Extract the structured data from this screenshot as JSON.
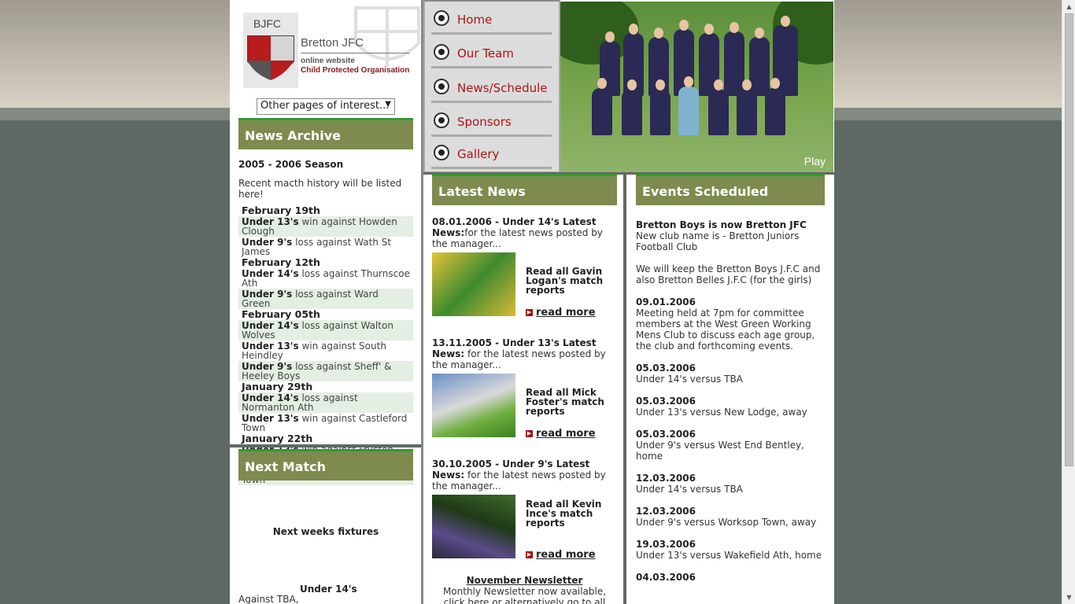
{
  "logo": {
    "abbr": "BJFC",
    "name": "Bretton JFC",
    "sub1": "online website",
    "sub2": "Child Protected Organisation"
  },
  "other_pages": {
    "label": "Other pages of interest..."
  },
  "nav": {
    "items": [
      {
        "label": "Home"
      },
      {
        "label": "Our Team"
      },
      {
        "label": "News/Schedule"
      },
      {
        "label": "Sponsors"
      },
      {
        "label": "Gallery"
      }
    ]
  },
  "photo": {
    "play_label": "Play"
  },
  "news_archive": {
    "heading": "News Archive",
    "season": "2005 - 2006 Season",
    "intro": "Recent macth history will be listed here!",
    "entries": [
      {
        "kind": "date",
        "text": "February 19th"
      },
      {
        "kind": "result",
        "team": "Under 13's",
        "text": " win against Howden Clough"
      },
      {
        "kind": "result",
        "team": "Under 9's",
        "text": " loss against Wath St James"
      },
      {
        "kind": "date",
        "text": "February 12th"
      },
      {
        "kind": "result",
        "team": "Under 14's",
        "text": " loss against Thurnscoe Ath"
      },
      {
        "kind": "result",
        "team": "Under 9's",
        "text": " loss against Ward Green"
      },
      {
        "kind": "date",
        "text": "February 05th"
      },
      {
        "kind": "result",
        "team": "Under 14's",
        "text": " loss against Walton Wolves"
      },
      {
        "kind": "result",
        "team": "Under 13's",
        "text": " win against South Heindley"
      },
      {
        "kind": "result",
        "team": "Under 9's",
        "text": " loss against Sheff' & Heeley Boys"
      },
      {
        "kind": "date",
        "text": "January 29th"
      },
      {
        "kind": "result",
        "team": "Under 14's",
        "text": " loss against Normanton Ath"
      },
      {
        "kind": "result",
        "team": "Under 13's",
        "text": " win against Castleford Town"
      },
      {
        "kind": "date",
        "text": "January 22th"
      },
      {
        "kind": "result",
        "team": "Under 13's",
        "text": " win against Fryston Juniors"
      },
      {
        "kind": "result",
        "team": "Under 9's",
        "text": " loss against Hoyland Town"
      }
    ]
  },
  "next_match": {
    "heading": "Next Match",
    "fixtures": "Next weeks fixtures",
    "age": "Under 14's",
    "against": "Against TBA,"
  },
  "latest_news": {
    "heading": "Latest News",
    "items": [
      {
        "bold": "08.01.2006 - Under 14's Latest News:",
        "text": "for the latest news posted by the manager...",
        "link": "Read all Gavin Logan's match reports",
        "read_more": "read more"
      },
      {
        "bold": "13.11.2005 - Under 13's Latest News:",
        "text": " for the latest news posted by the manager...",
        "link": "Read all Mick Foster's match reports",
        "read_more": "read more"
      },
      {
        "bold": "30.10.2005 - Under 9's Latest News:",
        "text": " for the latest news posted by the manager...",
        "link": "Read all Kevin Ince's match reports",
        "read_more": "read more"
      }
    ],
    "newsletter_title": "November Newsletter",
    "newsletter_text": "Monthly Newsletter now available, click here or alternatively go to all manager"
  },
  "events": {
    "heading": "Events Scheduled",
    "items": [
      {
        "title": "Bretton Boys is now Bretton JFC",
        "text": "New club name is - Bretton Juniors Football Club\n\nWe will keep the Bretton Boys J.F.C and also Bretton Belles J.F.C (for the girls)"
      },
      {
        "title": "09.01.2006",
        "text": "Meeting held at 7pm for committee members at the West Green Working Mens Club to discuss each age group, the club and forthcoming events."
      },
      {
        "title": "05.03.2006",
        "text": "Under 14's versus TBA"
      },
      {
        "title": "05.03.2006",
        "text": "Under 13's versus New Lodge, away"
      },
      {
        "title": "05.03.2006",
        "text": "Under 9's versus West End Bentley, home"
      },
      {
        "title": "12.03.2006",
        "text": "Under 14's versus TBA"
      },
      {
        "title": "12.03.2006",
        "text": "Under 9's versus Worksop Town, away"
      },
      {
        "title": "19.03.2006",
        "text": "Under 13's versus Wakefield Ath, home"
      },
      {
        "title": "04.03.2006",
        "text": ""
      }
    ]
  },
  "colors": {
    "section_head": "#7d8b4f",
    "nav_text": "#b01414",
    "archive_shade": "#e3efe3",
    "page_bg": "#5f6963"
  }
}
